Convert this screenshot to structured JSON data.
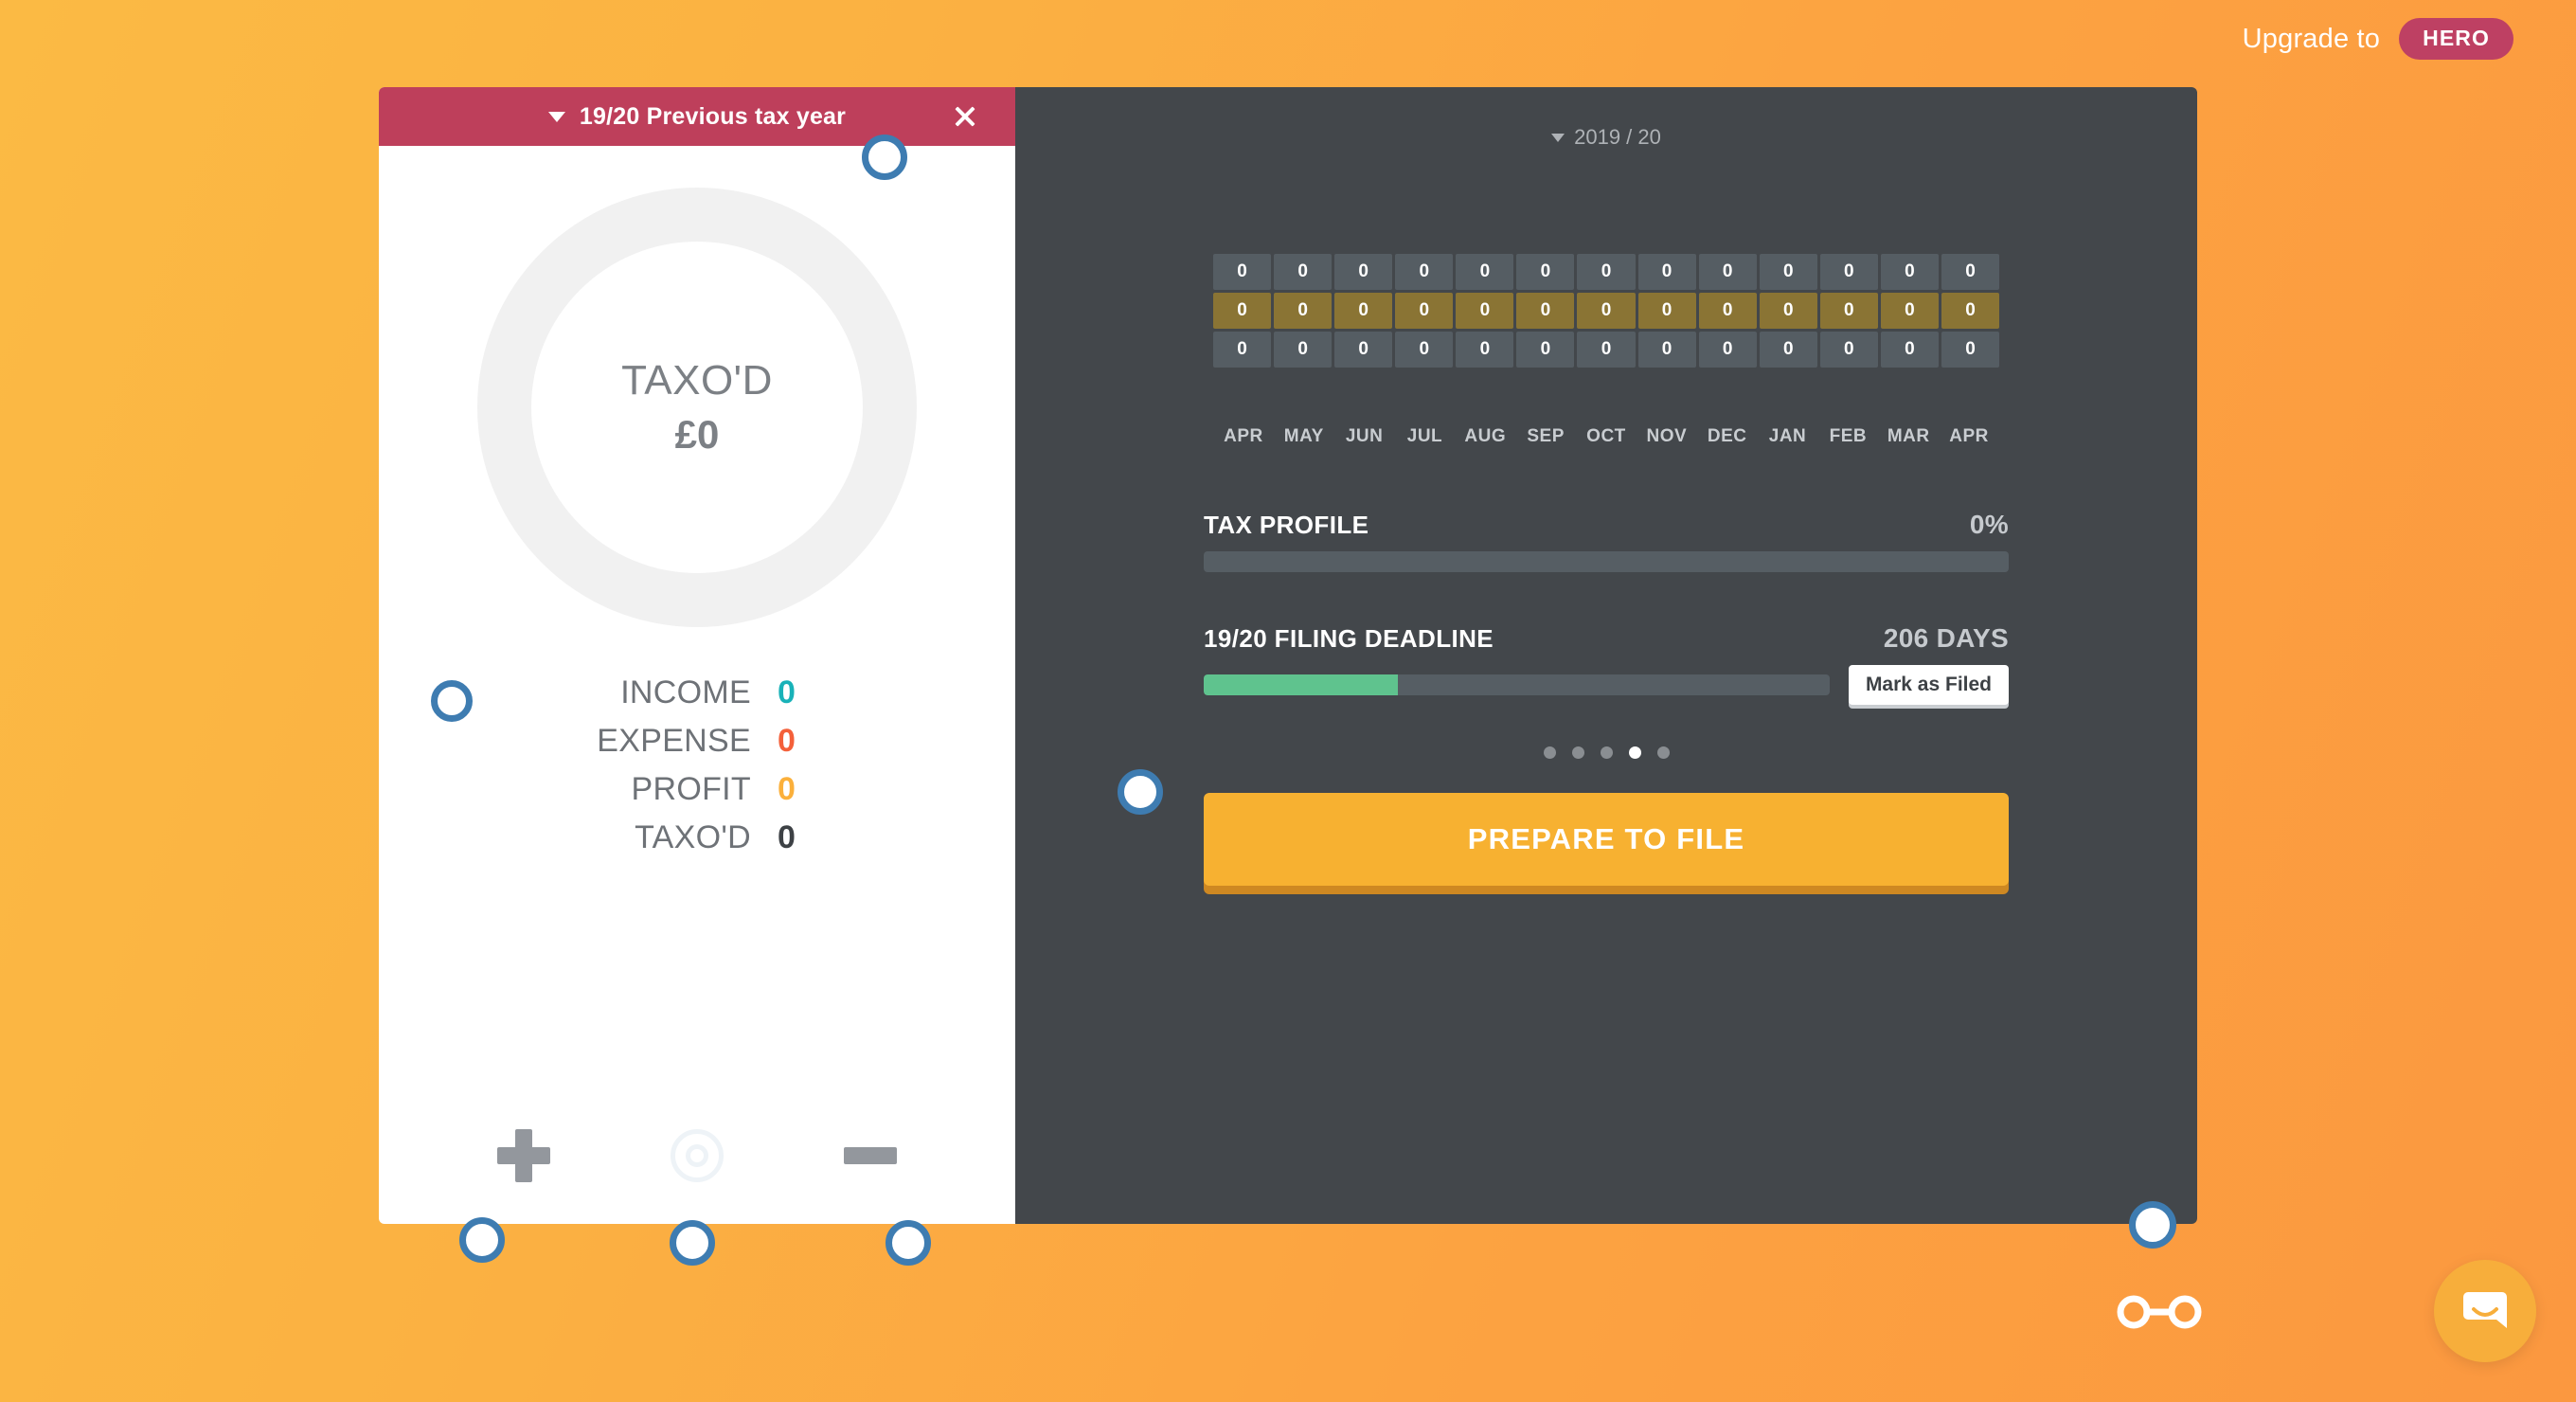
{
  "topbar": {
    "upgrade_label": "Upgrade to",
    "hero_badge": "HERO",
    "badge_color": "#BE4063"
  },
  "left_panel": {
    "header": {
      "caret_icon": "caret-down-icon",
      "title": "19/20 Previous tax year",
      "close_icon": "close-icon",
      "background_color": "#BE3F5B"
    },
    "donut": {
      "title": "TAXO'D",
      "value": "£0",
      "ring_color": "#F1F1F1"
    },
    "stats": [
      {
        "label": "INCOME",
        "value": "0",
        "color": "#19B2B8"
      },
      {
        "label": "EXPENSE",
        "value": "0",
        "color": "#F4603A"
      },
      {
        "label": "PROFIT",
        "value": "0",
        "color": "#FBB03B"
      },
      {
        "label": "TAXO'D",
        "value": "0",
        "color": "#3D4145"
      }
    ],
    "actions": [
      {
        "icon": "plus-icon"
      },
      {
        "icon": "target-circle-icon"
      },
      {
        "icon": "minus-icon"
      }
    ]
  },
  "right_panel": {
    "background_color": "#43474B",
    "year_picker": {
      "caret_icon": "caret-down-icon",
      "label": "2019 / 20"
    },
    "months": [
      "APR",
      "MAY",
      "JUN",
      "JUL",
      "AUG",
      "SEP",
      "OCT",
      "NOV",
      "DEC",
      "JAN",
      "FEB",
      "MAR",
      "APR"
    ],
    "tax_profile": {
      "title": "TAX PROFILE",
      "percent": "0%",
      "fill_percent": 0
    },
    "filing_deadline": {
      "title": "19/20 FILING DEADLINE",
      "days": "206 DAYS",
      "fill_percent": 31,
      "fill_color": "#5FC38E",
      "mark_as_filed_label": "Mark as Filed"
    },
    "carousel": {
      "count": 5,
      "active_index": 3
    },
    "prepare_button": {
      "label": "PREPARE TO FILE",
      "color": "#F7B131"
    }
  },
  "chart_data": {
    "type": "heatmap",
    "title": "2019 / 20",
    "xlabel": "",
    "ylabel": "",
    "categories": [
      "APR",
      "MAY",
      "JUN",
      "JUL",
      "AUG",
      "SEP",
      "OCT",
      "NOV",
      "DEC",
      "JAN",
      "FEB",
      "MAR",
      "APR"
    ],
    "series": [
      {
        "name": "income",
        "values": [
          0,
          0,
          0,
          0,
          0,
          0,
          0,
          0,
          0,
          0,
          0,
          0,
          0
        ],
        "color": "#555D63"
      },
      {
        "name": "expense",
        "values": [
          0,
          0,
          0,
          0,
          0,
          0,
          0,
          0,
          0,
          0,
          0,
          0,
          0
        ],
        "color": "#8A7434"
      },
      {
        "name": "profit",
        "values": [
          0,
          0,
          0,
          0,
          0,
          0,
          0,
          0,
          0,
          0,
          0,
          0,
          0
        ],
        "color": "#555D63"
      }
    ],
    "grid": false,
    "legend": "none"
  },
  "overlay": {
    "glasses_icon": "glasses-icon",
    "intercom_icon": "chat-bubble-icon",
    "marker_color": "#3E7CB1"
  }
}
